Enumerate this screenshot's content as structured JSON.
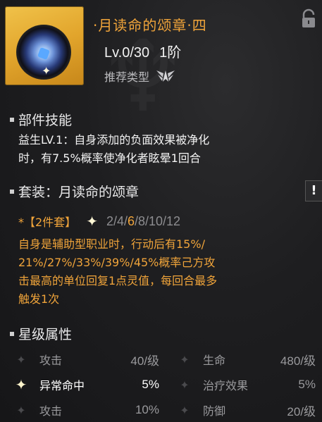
{
  "item": {
    "title": "·月读命的颂章·四",
    "level": "Lv.0/30",
    "rank": "1阶",
    "recommend_label": "推荐类型",
    "recommend_icon": "wings-emblem-icon"
  },
  "skill": {
    "heading": "部件技能",
    "text_line1": "益生LV.1：自身添加的负面效果被净化",
    "text_line2": "时，有7.5%概率使净化者眩晕1回合"
  },
  "set": {
    "heading": "套装：月读命的颂章",
    "tag": "*【2件套】",
    "counts": [
      "2/4/",
      "6",
      "/8/10/12"
    ],
    "desc_line1": "自身是辅助型职业时，行动后有15%/",
    "desc_line2": "21%/27%/33%/39%/45%概率己方攻",
    "desc_line3": "击最高的单位回复1点灵值，每回合最多",
    "desc_line4": "触发1次",
    "warn_label": "!"
  },
  "stars": {
    "heading": "星级属性",
    "rows": [
      [
        {
          "name": "攻击",
          "value": "40/级",
          "active": false
        },
        {
          "name": "生命",
          "value": "480/级",
          "active": false
        }
      ],
      [
        {
          "name": "异常命中",
          "value": "5%",
          "active": true
        },
        {
          "name": "治疗效果",
          "value": "5%",
          "active": false
        }
      ],
      [
        {
          "name": "攻击",
          "value": "10%",
          "active": false
        },
        {
          "name": "防御",
          "value": "20/级",
          "active": false
        }
      ]
    ]
  },
  "colors": {
    "accent": "#f0a43a",
    "bg": "#1e1e20"
  }
}
